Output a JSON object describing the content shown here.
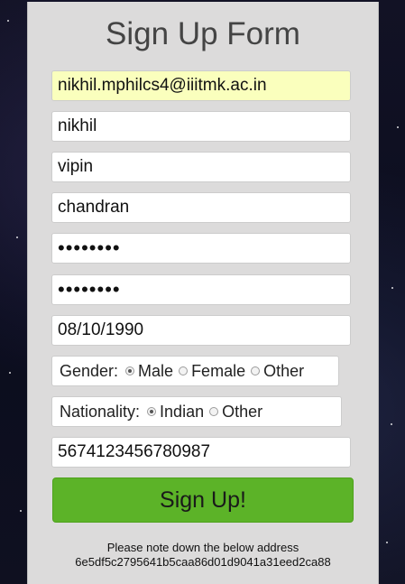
{
  "form": {
    "title": "Sign Up Form",
    "email": "nikhil.mphilcs4@iiitmk.ac.in",
    "first_name": "nikhil",
    "middle_name": "vipin",
    "last_name": "chandran",
    "password": "••••••••",
    "confirm_password": "••••••••",
    "dob": "08/10/1990",
    "gender": {
      "label": "Gender:",
      "options": [
        "Male",
        "Female",
        "Other"
      ],
      "selected": "Male"
    },
    "nationality": {
      "label": "Nationality:",
      "options": [
        "Indian",
        "Other"
      ],
      "selected": "Indian"
    },
    "phone": "5674123456780987",
    "submit_label": "Sign Up!",
    "note_line1": "Please note down the below address",
    "note_line2": "6e5df5c2795641b5caa86d01d9041a31eed2ca88"
  },
  "colors": {
    "autofill_bg": "#faffbd",
    "button_green": "#5cb328",
    "panel_bg": "#dcdbdb"
  }
}
